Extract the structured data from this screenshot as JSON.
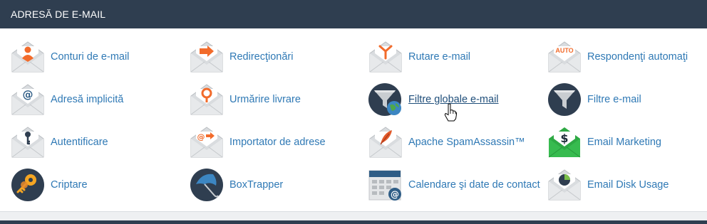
{
  "section": {
    "title": "ADRESĂ DE E-MAIL"
  },
  "items": [
    {
      "label": "Conturi de e-mail",
      "icon": "user-envelope-icon"
    },
    {
      "label": "Redirecţionări",
      "icon": "forward-arrow-envelope-icon"
    },
    {
      "label": "Rutare e-mail",
      "icon": "routing-envelope-icon"
    },
    {
      "label": "Respondenţi automaţi",
      "icon": "auto-envelope-icon",
      "badge": "AUTO"
    },
    {
      "label": "Adresă implicită",
      "icon": "at-envelope-icon"
    },
    {
      "label": "Urmărire livrare",
      "icon": "location-pin-envelope-icon"
    },
    {
      "label": "Filtre globale e-mail",
      "icon": "funnel-globe-icon"
    },
    {
      "label": "Filtre e-mail",
      "icon": "funnel-icon"
    },
    {
      "label": "Autentificare",
      "icon": "key-envelope-icon"
    },
    {
      "label": "Importator de adrese",
      "icon": "import-envelope-icon"
    },
    {
      "label": "Apache SpamAssassin™",
      "icon": "feather-envelope-icon"
    },
    {
      "label": "Email Marketing",
      "icon": "dollar-envelope-icon"
    },
    {
      "label": "Criptare",
      "icon": "keys-icon"
    },
    {
      "label": "BoxTrapper",
      "icon": "umbrella-icon"
    },
    {
      "label": "Calendare şi date de contact",
      "icon": "calendar-icon"
    },
    {
      "label": "Email Disk Usage",
      "icon": "pie-envelope-icon"
    }
  ],
  "colors": {
    "header_bg": "#2f3e50",
    "link": "#2f79b5",
    "accent_orange": "#f26b2b",
    "accent_green": "#2ea944",
    "envelope_gray": "#dfe1e3"
  }
}
